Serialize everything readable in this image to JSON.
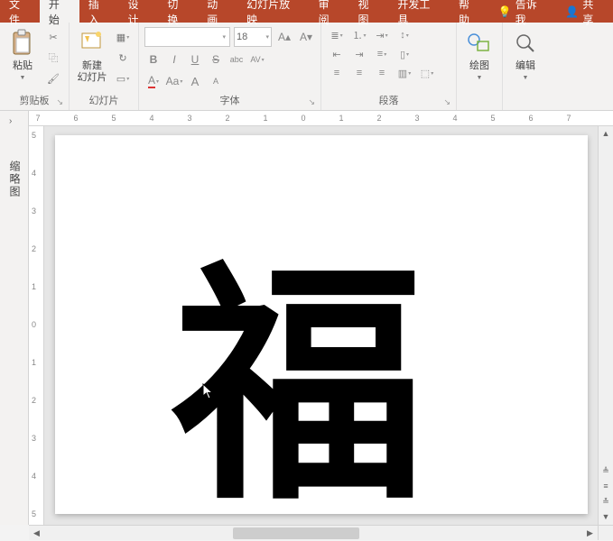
{
  "tabs": {
    "file": "文件",
    "home": "开始",
    "insert": "插入",
    "design": "设计",
    "transitions": "切换",
    "animations": "动画",
    "slideshow": "幻灯片放映",
    "review": "审阅",
    "view": "视图",
    "developer": "开发工具",
    "help": "帮助",
    "tell_me": "告诉我",
    "share": "共享"
  },
  "ribbon": {
    "clipboard": {
      "label": "剪贴板",
      "paste": "粘贴"
    },
    "slides": {
      "label": "幻灯片",
      "new_slide": "新建\n幻灯片"
    },
    "font": {
      "label": "字体",
      "name": "",
      "size": "18",
      "bold": "B",
      "italic": "I",
      "underline": "U",
      "strike": "S",
      "shadow": "abc",
      "spacing": "AV",
      "color": "A",
      "case": "Aa",
      "sizeup": "A",
      "sizedown": "A"
    },
    "paragraph": {
      "label": "段落"
    },
    "drawing": {
      "label": "绘图"
    },
    "editing": {
      "label": "编辑"
    }
  },
  "left_panel": {
    "label": "缩略图"
  },
  "slide": {
    "content": "福"
  },
  "ruler": {
    "h": [
      "7",
      "6",
      "5",
      "4",
      "3",
      "2",
      "1",
      "0",
      "1",
      "2",
      "3",
      "4",
      "5",
      "6",
      "7"
    ],
    "v": [
      "5",
      "4",
      "3",
      "2",
      "1",
      "0",
      "1",
      "2",
      "3",
      "4",
      "5"
    ]
  }
}
